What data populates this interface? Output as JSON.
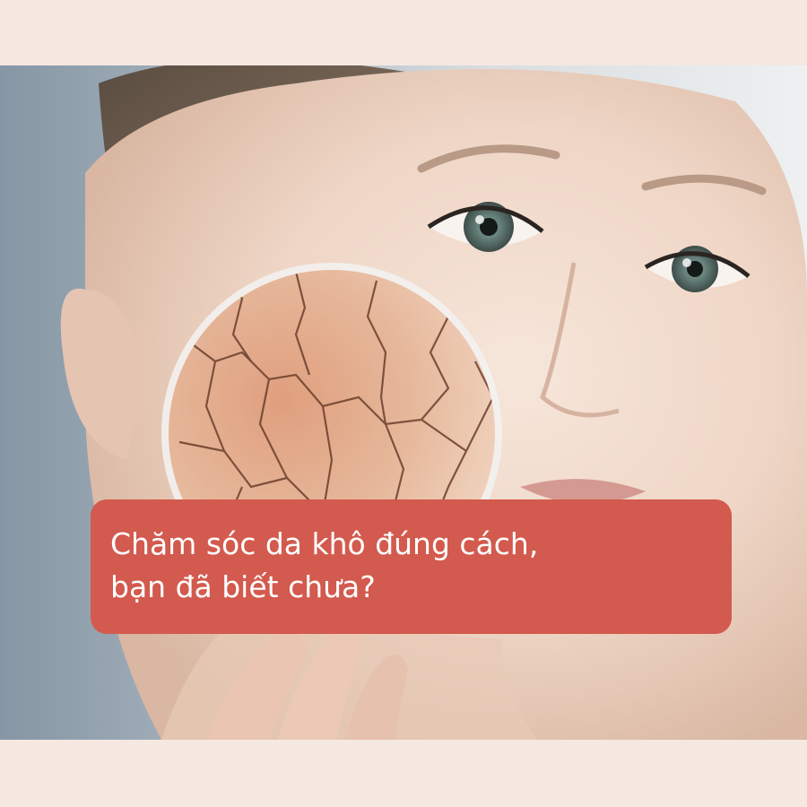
{
  "caption": {
    "line1": "Chăm sóc da khô đúng cách,",
    "line2": "bạn đã biết chưa?"
  },
  "colors": {
    "background": "#f4e8e1",
    "caption_bg": "#d35a4e",
    "caption_text": "#ffffff",
    "dry_skin": "#d89a78"
  },
  "image": {
    "subject": "woman-face-with-magnified-dry-cracked-skin"
  }
}
